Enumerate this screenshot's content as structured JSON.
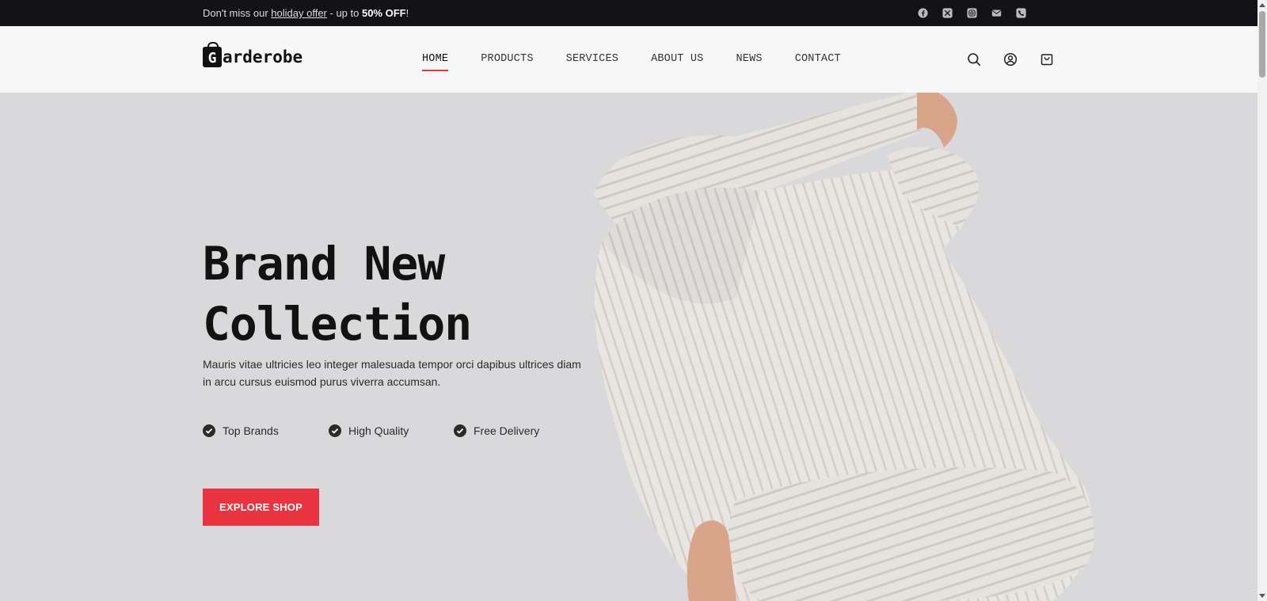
{
  "announcement": {
    "prefix": "Don't miss our ",
    "link": "holiday offer",
    "middle": " - up to ",
    "highlight": "50% OFF",
    "suffix": "!"
  },
  "social": [
    "facebook-icon",
    "x-icon",
    "instagram-icon",
    "mail-icon",
    "phone-icon"
  ],
  "brand": {
    "initial": "G",
    "rest": "arderobe"
  },
  "nav": [
    {
      "label": "HOME",
      "active": true
    },
    {
      "label": "PRODUCTS",
      "active": false
    },
    {
      "label": "SERVICES",
      "active": false
    },
    {
      "label": "ABOUT US",
      "active": false
    },
    {
      "label": "NEWS",
      "active": false
    },
    {
      "label": "CONTACT",
      "active": false
    }
  ],
  "header_icons": [
    "search-icon",
    "user-icon",
    "cart-icon"
  ],
  "hero": {
    "title_line1": "Brand New",
    "title_line2": "Collection",
    "description": "Mauris vitae ultricies leo integer malesuada tempor orci dapibus ultrices diam in arcu cursus euismod purus viverra accumsan.",
    "features": [
      "Top Brands",
      "High Quality",
      "Free Delivery"
    ],
    "cta": "EXPLORE SHOP"
  },
  "colors": {
    "accent": "#e9343f",
    "topbar": "#131217",
    "hero_bg": "#d9d9db"
  }
}
